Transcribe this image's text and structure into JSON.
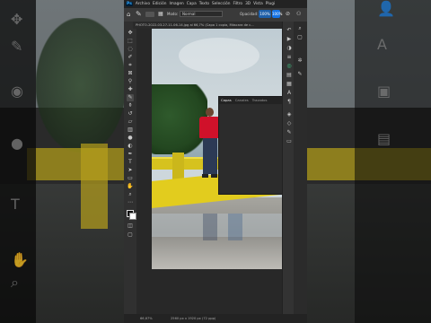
{
  "menu": {
    "items": [
      "Archivo",
      "Edición",
      "Imagen",
      "Capa",
      "Texto",
      "Selección",
      "Filtro",
      "3D",
      "Vista",
      "Plugi"
    ]
  },
  "options_bar": {
    "mode_label": "Modo:",
    "mode_value": "Normal",
    "opacity_label": "Opacidad:",
    "opacity_value": "100%",
    "chip": "100%"
  },
  "document": {
    "tab_title": "PHOTO-2022-03-27-11-06-14.jpg al 66,7% (Capa 1 copia, Máscara de c..."
  },
  "layers_panel": {
    "tabs": [
      "Capas",
      "Canales",
      "Trazados"
    ]
  },
  "status_bar": {
    "zoom": "66,67%",
    "info": "2560 px x 1920 px (72 ppp)"
  },
  "colors": {
    "accent": "#31a8ff",
    "panel_bg": "#2f2f2f",
    "menubar_bg": "#232323",
    "shirt_red": "#d0112a",
    "railing_yellow": "#d6c21e"
  },
  "icons": {
    "toolbar": [
      "move-icon",
      "marquee-icon",
      "lasso-icon",
      "quick-select-icon",
      "crop-icon",
      "frame-icon",
      "eyedropper-icon",
      "healing-icon",
      "brush-icon",
      "stamp-icon",
      "history-brush-icon",
      "eraser-icon",
      "gradient-icon",
      "blur-icon",
      "dodge-icon",
      "pen-icon",
      "type-icon",
      "path-select-icon",
      "shape-icon",
      "hand-icon",
      "zoom-icon",
      "edit-toolbar-icon",
      "colors-icon",
      "quick-mask-icon",
      "screen-mode-icon"
    ]
  }
}
